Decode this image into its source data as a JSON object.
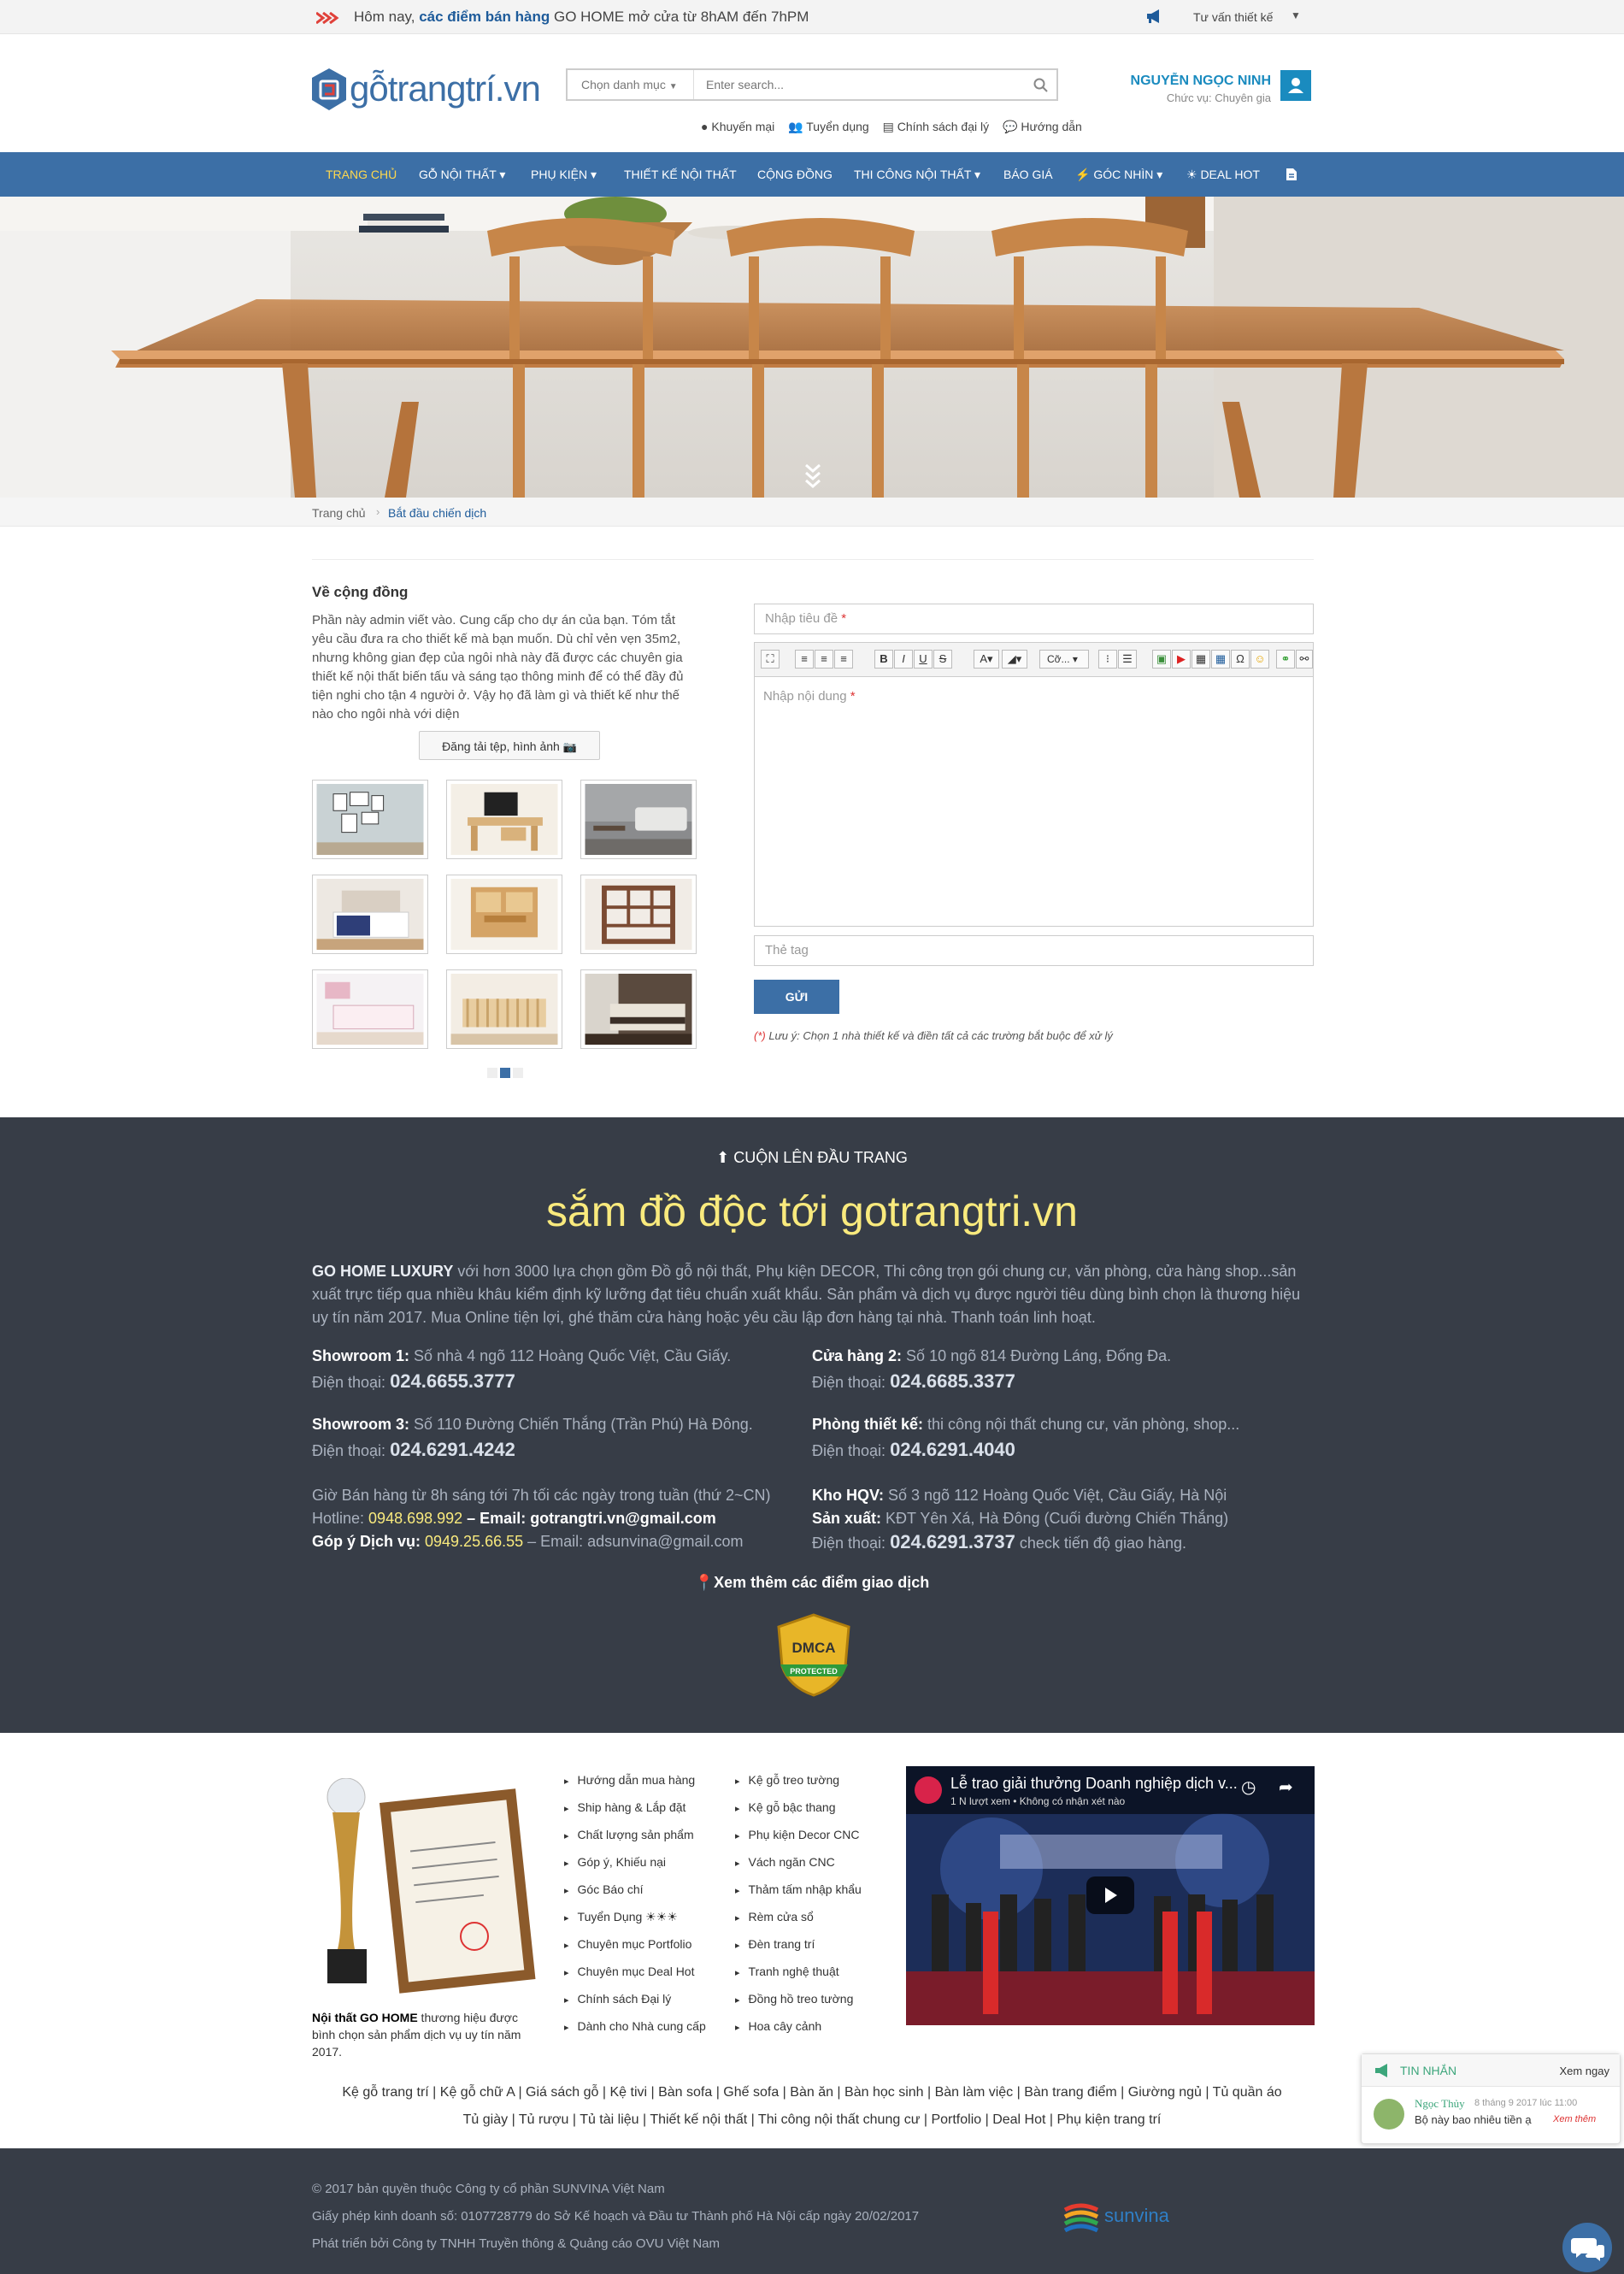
{
  "topbar": {
    "promo_prefix": "Hôm nay, ",
    "promo_bold": "các điểm bán hàng",
    "promo_suffix": " GO HOME mở cửa từ 8hAM đến 7hPM",
    "consult_label": "Tư vấn thiết kế"
  },
  "header": {
    "logo_text": "gỗtrangtrí.vn",
    "search": {
      "category_label": "Chọn danh mục",
      "placeholder": "Enter search..."
    },
    "quick_links": [
      "Khuyến mại",
      "Tuyển dụng",
      "Chính sách đại lý",
      "Hướng dẫn"
    ],
    "user": {
      "name": "NGUYỄN NGỌC NINH",
      "role": "Chức vụ: Chuyên gia"
    }
  },
  "nav": {
    "items": [
      {
        "label": "TRANG CHỦ",
        "active": true
      },
      {
        "label": "GỖ NỘI THẤT ▾"
      },
      {
        "label": "PHỤ KIỆN ▾"
      },
      {
        "label": "THIẾT KẾ NỘI THẤT"
      },
      {
        "label": "CỘNG ĐỒNG"
      },
      {
        "label": "THI CÔNG NỘI THẤT ▾"
      },
      {
        "label": "BÁO GIÁ"
      },
      {
        "label": "⚡ GÓC NHÌN ▾"
      },
      {
        "label": "☀ DEAL HOT"
      }
    ]
  },
  "breadcrumb": {
    "home": "Trang chủ",
    "current": "Bắt đầu chiến dịch"
  },
  "community": {
    "title": "Về cộng đồng",
    "description": "Phần này admin viết vào. Cung cấp cho dự án của bạn. Tóm tắt yêu cầu đưa ra cho thiết kế mà bạn muốn. Dù chỉ vẻn vẹn 35m2, nhưng không gian đẹp của ngôi nhà này đã được các chuyên gia thiết kế nội thất biến tấu và sáng tạo thông minh để có thể đầy đủ tiện nghi cho tận 4 người ở. Vậy họ đã làm gì và thiết kế như thế nào cho ngôi nhà với diện",
    "upload_label": "Đăng tải tệp, hình ảnh"
  },
  "form": {
    "title_placeholder": "Nhập tiêu đề",
    "content_placeholder": "Nhập nội dung",
    "required_mark": "*",
    "font_select": "Cỡ...",
    "tag_placeholder": "Thẻ tag",
    "submit_label": "GỬI",
    "note_mark": "(*)",
    "note": " Lưu ý: Chọn 1 nhà thiết kế và điền tất cả các trường bắt buộc để xử lý"
  },
  "footer_info": {
    "to_top": "CUỘN LÊN ĐẦU TRANG",
    "headline": "sắm đồ độc tới gotrangtri.vn",
    "intro_brand": "GO HOME LUXURY",
    "intro_text": " với hơn 3000 lựa chọn gồm Đồ gỗ nội thất, Phụ kiện DECOR, Thi công trọn gói chung cư, văn phòng, cửa hàng shop...sản xuất trực tiếp qua nhiều khâu kiểm định kỹ lưỡng đạt tiêu chuẩn xuất khẩu. Sản phẩm và dịch vụ được người tiêu dùng bình chọn là thương hiệu uy tín năm 2017. Mua Online tiện lợi, ghé thăm cửa hàng hoặc yêu cầu lập đơn hàng tại nhà. Thanh toán linh hoạt.",
    "phone_label": "Điện thoại: ",
    "sr1_label": "Showroom 1:",
    "sr1_addr": " Số nhà 4 ngõ 112 Hoàng Quốc Việt, Cầu Giấy.",
    "sr1_phone": "024.6655.3777",
    "ch2_label": "Cửa hàng 2:",
    "ch2_addr": " Số 10 ngõ 814 Đường Láng, Đống Đa.",
    "ch2_phone": "024.6685.3377",
    "sr3_label": "Showroom 3:",
    "sr3_addr": " Số 110 Đường Chiến Thắng (Trần Phú) Hà Đông.",
    "sr3_phone": "024.6291.4242",
    "ptk_label": "Phòng thiết kế:",
    "ptk_addr": " thi công nội thất chung cư, văn phòng, shop...",
    "ptk_phone": "024.6291.4040",
    "hours": "Giờ Bán hàng từ 8h sáng tới 7h tối các ngày trong tuần (thứ 2~CN)",
    "hotline_label": "Hotline: ",
    "hotline": "0948.698.992",
    "email_label": " – Email: gotrangtri.vn@gmail.com",
    "gopy_label": "Góp ý Dịch vụ: ",
    "gopy_phone": "0949.25.66.55",
    "gopy_email": " – Email: adsunvina@gmail.com",
    "kho_label": "Kho HQV:",
    "kho_addr": " Số 3 ngõ 112 Hoàng Quốc Việt, Cầu Giấy, Hà Nội",
    "sx_label": "Sản xuất:",
    "sx_addr": " KĐT Yên Xá, Hà Đông (Cuối đường Chiến Thắng)",
    "sx_phone": "024.6291.3737",
    "sx_suffix": " check tiến độ giao hàng.",
    "more_locations": "Xem thêm các điểm giao dịch",
    "dmca_text": "DMCA",
    "dmca_sub": "PROTECTED"
  },
  "links": {
    "col1": [
      "Hướng dẫn mua hàng",
      "Ship hàng & Lắp đặt",
      "Chất lượng sản phẩm",
      "Góp ý, Khiếu nại",
      "Góc Báo chí",
      "Tuyển Dụng ☀☀☀",
      "Chuyên mục Portfolio",
      "Chuyên mục Deal Hot",
      "Chính sách Đại lý",
      "Dành cho Nhà cung cấp"
    ],
    "col2": [
      "Kệ gỗ treo tường",
      "Kệ gỗ bậc thang",
      "Phụ kiện Decor CNC",
      "Vách ngăn CNC",
      "Thảm tấm nhập khẩu",
      "Rèm cửa sổ",
      "Đèn trang trí",
      "Tranh nghệ thuật",
      "Đồng hồ treo tường",
      "Hoa cây cảnh"
    ]
  },
  "award": {
    "brand": "Nội thất GO HOME",
    "caption": " thương hiệu được bình chọn sản phẩm dịch vụ uy tín năm 2017."
  },
  "video": {
    "title": "Lễ trao giải thưởng Doanh nghiệp dịch v...",
    "subtitle": "1 N lượt xem • Không có nhận xét nào"
  },
  "tags": {
    "line1": "Kệ gỗ trang trí | Kệ gỗ chữ A | Giá sách gỗ | Kệ tivi | Bàn sofa | Ghế sofa | Bàn ăn | Bàn học sinh | Bàn làm việc | Bàn trang điểm | Giường ngủ | Tủ quần áo",
    "line2": "Tủ giày | Tủ rượu | Tủ tài liệu | Thiết kế nội thất | Thi công nội thất chung cư | Portfolio | Deal Hot | Phụ kiện trang trí"
  },
  "footer": {
    "copyright": "© 2017 bản quyền thuộc Công ty cổ phần SUNVINA Việt Nam",
    "license": "Giấy phép kinh doanh số: 0107728779 do Sở Kế hoạch và Đầu tư Thành phố Hà Nội cấp ngày 20/02/2017",
    "developer": "Phát triển bởi Công ty TNHH Truyền thông & Quảng cáo OVU Việt Nam",
    "partner_logo": "sunvina"
  },
  "chat": {
    "title": "TIN NHẮN",
    "view_now": "Xem ngay",
    "sender": "Ngọc Thủy",
    "time": "8 tháng 9 2017 lúc 11:00",
    "message": "Bộ này bao nhiêu tiền ạ",
    "see_more": "Xem thêm"
  },
  "colors": {
    "nav_bg": "#3c6fa6",
    "accent_blue": "#1a8bbf",
    "footer_bg": "#373d47",
    "headline_yellow": "#f9ea7d"
  }
}
